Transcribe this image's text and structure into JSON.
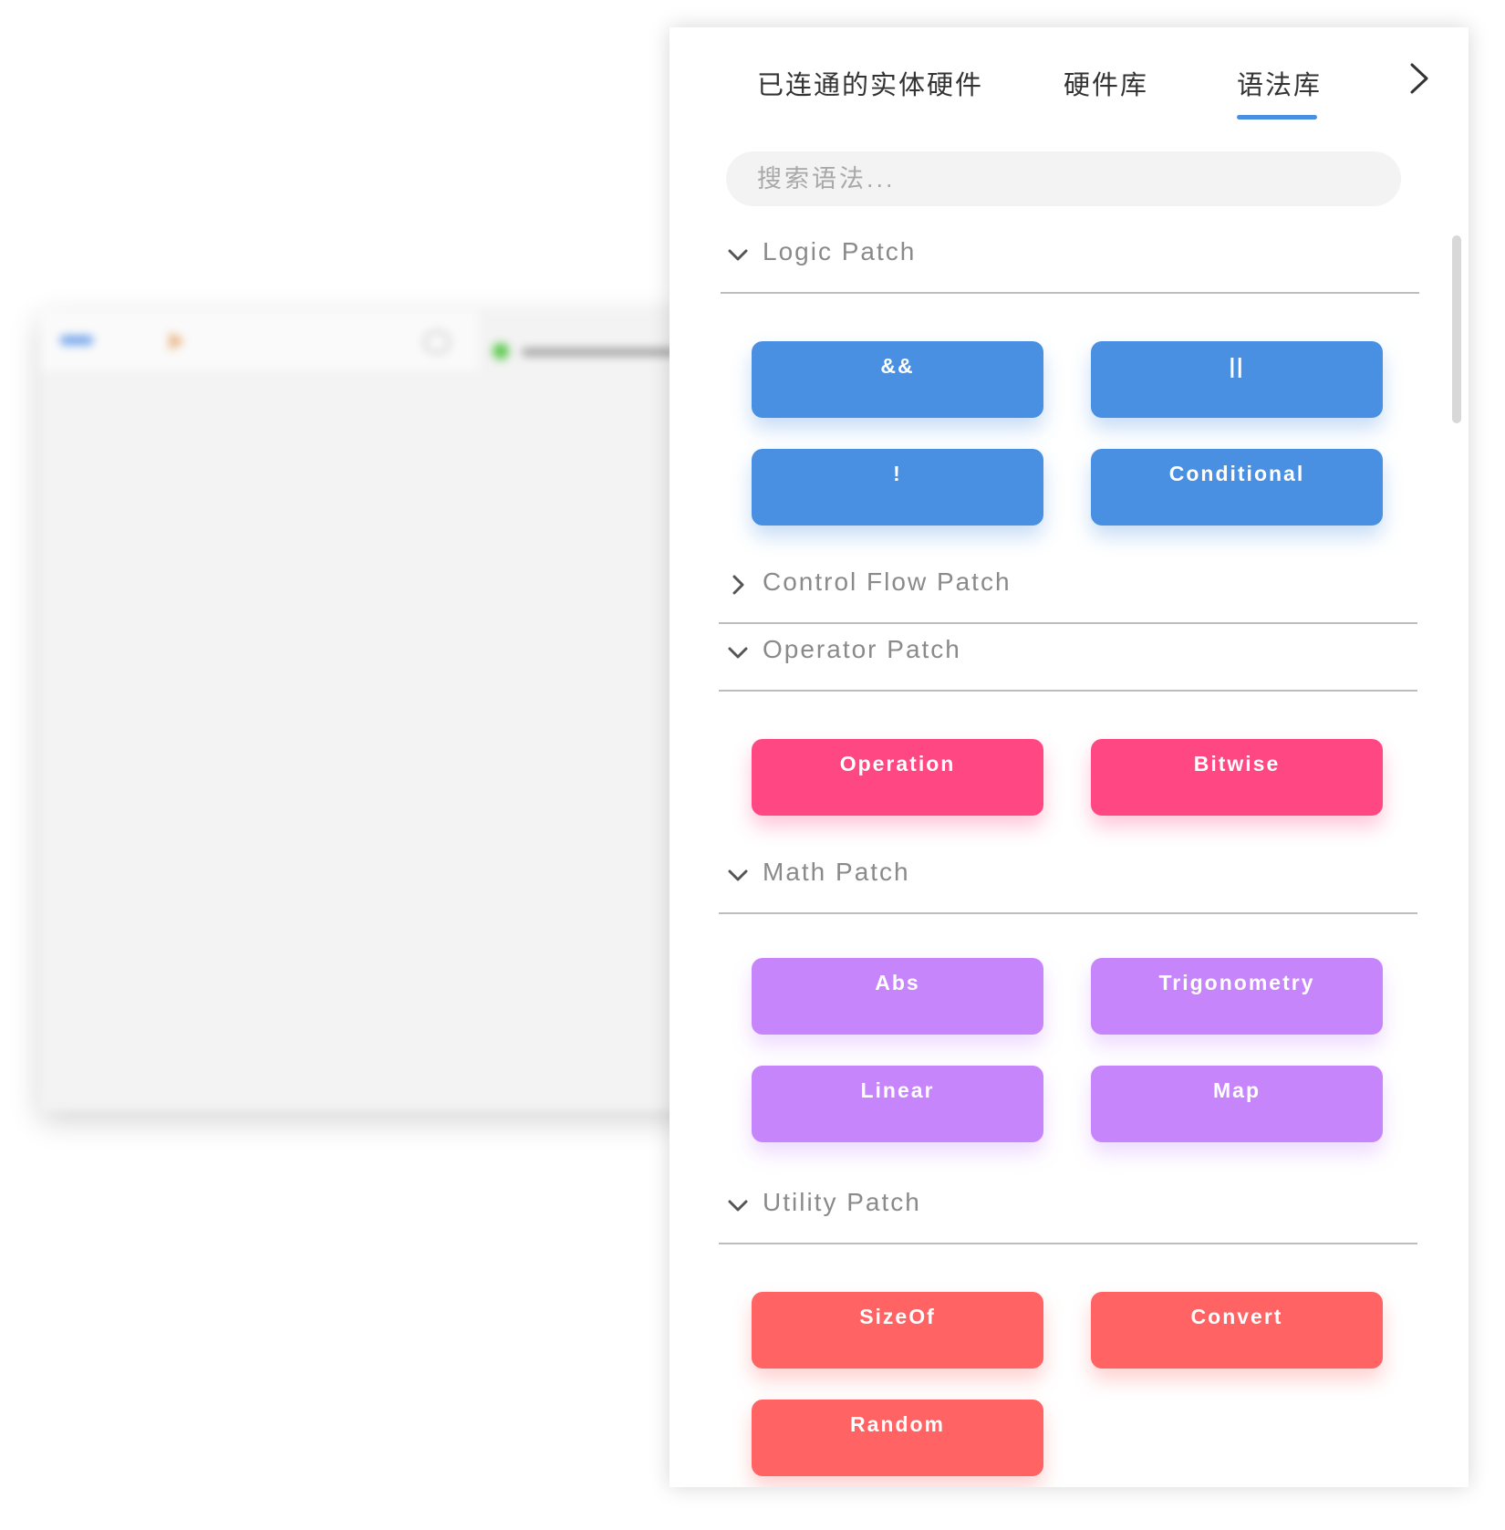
{
  "tabs": {
    "connected_hardware": "已连通的实体硬件",
    "hardware_library": "硬件库",
    "grammar_library": "语法库",
    "active": "语法库",
    "next_icon": "chevron-right-icon"
  },
  "search": {
    "placeholder": "搜索语法...",
    "value": ""
  },
  "sections": {
    "logic": {
      "title": "Logic Patch",
      "expanded": true,
      "color": "#4a90e2",
      "items": [
        "&&",
        "||",
        "!",
        "Conditional"
      ]
    },
    "control_flow": {
      "title": "Control Flow Patch",
      "expanded": false
    },
    "operator": {
      "title": "Operator Patch",
      "expanded": true,
      "color": "#ff4784",
      "items": [
        "Operation",
        "Bitwise"
      ]
    },
    "math": {
      "title": "Math Patch",
      "expanded": true,
      "color": "#c785fc",
      "items": [
        "Abs",
        "Trigonometry",
        "Linear",
        "Map"
      ]
    },
    "utility": {
      "title": "Utility Patch",
      "expanded": true,
      "color": "#ff6363",
      "items": [
        "SizeOf",
        "Convert",
        "Random"
      ]
    }
  },
  "colors": {
    "accent": "#4a90e2",
    "tab_underline": "#4a90e2"
  }
}
